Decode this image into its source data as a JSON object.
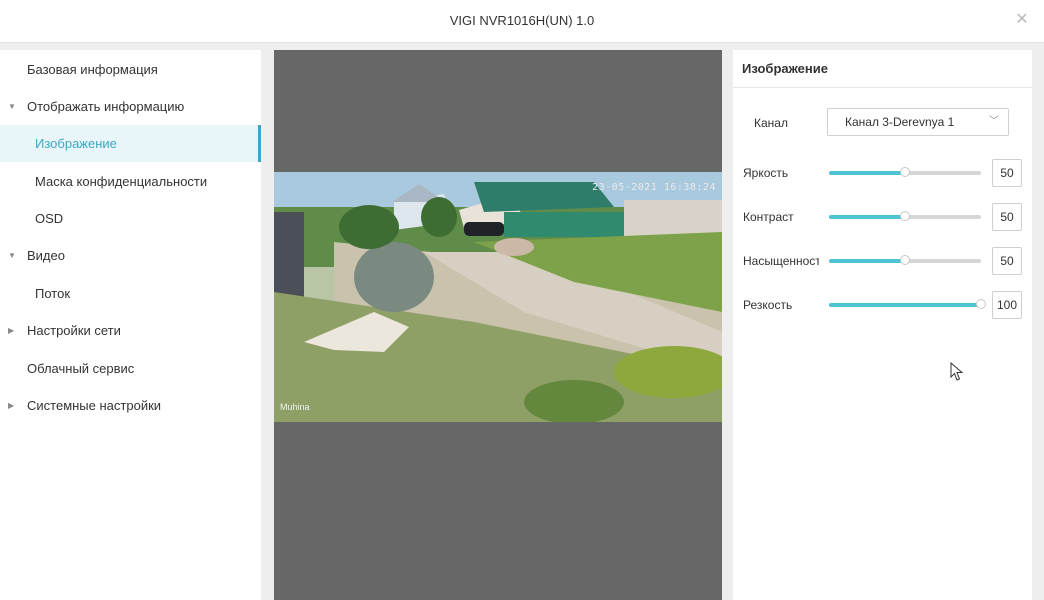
{
  "window": {
    "title": "VIGI NVR1016H(UN) 1.0",
    "close_icon": "close-icon"
  },
  "sidebar": {
    "items": [
      {
        "label": "Базовая информация"
      },
      {
        "label": "Отображать информацию",
        "expanded": true
      },
      {
        "label": "Изображение",
        "active": true
      },
      {
        "label": "Маска конфиденциальности"
      },
      {
        "label": "OSD"
      },
      {
        "label": "Видео",
        "expanded": true
      },
      {
        "label": "Поток"
      },
      {
        "label": "Настройки сети",
        "expanded": false
      },
      {
        "label": "Облачный сервис"
      },
      {
        "label": "Системные настройки",
        "expanded": false
      }
    ]
  },
  "preview": {
    "osd_time": "23-05-2021 16:38:24",
    "osd_name": "Muhina"
  },
  "panel": {
    "title": "Изображение",
    "channel_label": "Канал",
    "channel_value": "Канал 3-Derevnya 1",
    "sliders": [
      {
        "label": "Яркость",
        "value": "50",
        "fraction": 0.5
      },
      {
        "label": "Контраст",
        "value": "50",
        "fraction": 0.5
      },
      {
        "label": "Насыщенность",
        "value": "50",
        "fraction": 0.5
      },
      {
        "label": "Резкость",
        "value": "100",
        "fraction": 1.0
      }
    ]
  },
  "colors": {
    "accent": "#3ca8c4",
    "slider_fill": "#4cc4d4",
    "active_bg": "#e9f6f9"
  }
}
